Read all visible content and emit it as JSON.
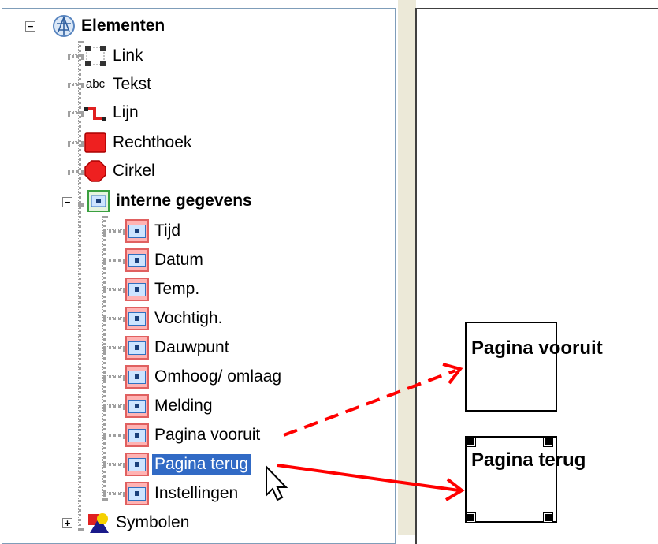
{
  "tree": {
    "root_label": "Elementen",
    "items": [
      {
        "label": "Link",
        "icon": "link-icon"
      },
      {
        "label": "Tekst",
        "icon": "text-icon"
      },
      {
        "label": "Lijn",
        "icon": "line-icon"
      },
      {
        "label": "Rechthoek",
        "icon": "rectangle-icon"
      },
      {
        "label": "Cirkel",
        "icon": "circle-icon"
      }
    ],
    "group_label": "interne gegevens",
    "group_items": [
      "Tijd",
      "Datum",
      "Temp.",
      "Vochtigh.",
      "Dauwpunt",
      "Omhoog/ omlaag",
      "Melding",
      "Pagina vooruit",
      "Pagina terug",
      "Instellingen"
    ],
    "selected": "Pagina terug",
    "symbols_label": "Symbolen",
    "expander_collapse": "−",
    "expander_expand": "+"
  },
  "canvas": {
    "box1_label": "Pagina vooruit",
    "box2_label": "Pagina terug"
  },
  "annotations": {
    "arrow_color": "#ff0000"
  },
  "colors": {
    "selection": "#316ac5",
    "accent": "#ff0000"
  }
}
